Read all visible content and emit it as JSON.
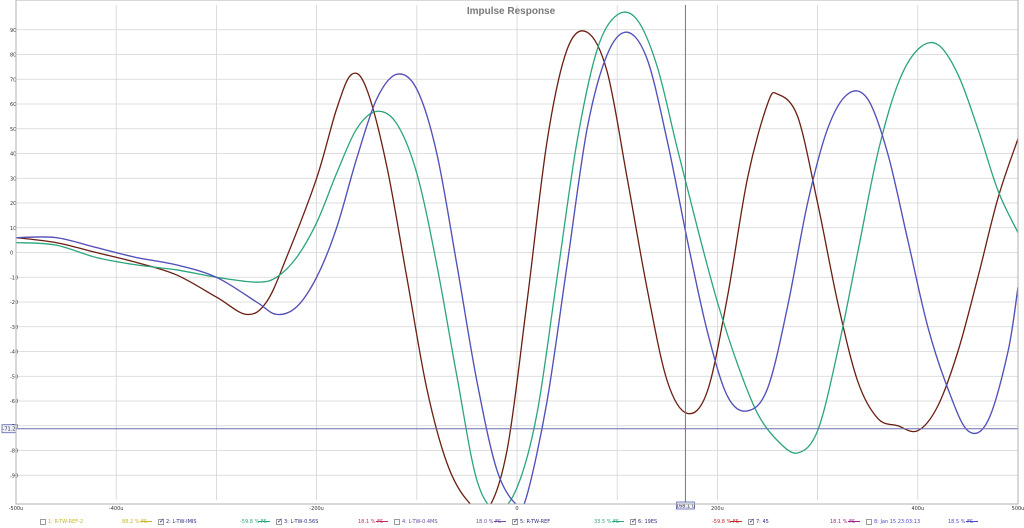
{
  "chart_data": {
    "type": "line",
    "title": "Impulse Response",
    "xlabel": "",
    "ylabel": "",
    "xlim": [
      -500,
      500
    ],
    "ylim": [
      -100,
      100
    ],
    "x_ticks": [
      {
        "value": -500,
        "label": "-500u"
      },
      {
        "value": -400,
        "label": "-400u"
      },
      {
        "value": -200,
        "label": "-200u"
      },
      {
        "value": 0,
        "label": "0"
      },
      {
        "value": 200,
        "label": "200u"
      },
      {
        "value": 400,
        "label": "400u"
      },
      {
        "value": 500,
        "label": "500u"
      }
    ],
    "y_ticks": [
      {
        "value": 90,
        "label": "90"
      },
      {
        "value": 80,
        "label": "80"
      },
      {
        "value": 70,
        "label": "70"
      },
      {
        "value": 60,
        "label": "60"
      },
      {
        "value": 50,
        "label": "50"
      },
      {
        "value": 40,
        "label": "40"
      },
      {
        "value": 30,
        "label": "30"
      },
      {
        "value": 20,
        "label": "20"
      },
      {
        "value": 10,
        "label": "10"
      },
      {
        "value": 0,
        "label": "0"
      },
      {
        "value": -10,
        "label": "-10"
      },
      {
        "value": -20,
        "label": "-20"
      },
      {
        "value": -30,
        "label": "-30"
      },
      {
        "value": -40,
        "label": "-40"
      },
      {
        "value": -50,
        "label": "-50"
      },
      {
        "value": -60,
        "label": "-60"
      },
      {
        "value": -70,
        "label": "-70"
      },
      {
        "value": -80,
        "label": "-80"
      },
      {
        "value": -90,
        "label": "-90"
      }
    ],
    "grid": true,
    "cursor": {
      "x": 168.1,
      "y": -71.2,
      "x_label": "168.1 u",
      "y_label": "-71.2"
    },
    "series": [
      {
        "name": "6: 19ES",
        "color": "#6b1e12",
        "points": [
          [
            -500,
            6
          ],
          [
            -460,
            4
          ],
          [
            -420,
            0
          ],
          [
            -380,
            -4
          ],
          [
            -340,
            -9
          ],
          [
            -300,
            -18
          ],
          [
            -270,
            -25
          ],
          [
            -250,
            -20
          ],
          [
            -230,
            -2
          ],
          [
            -200,
            30
          ],
          [
            -180,
            58
          ],
          [
            -165,
            72
          ],
          [
            -150,
            66
          ],
          [
            -130,
            35
          ],
          [
            -110,
            -10
          ],
          [
            -90,
            -55
          ],
          [
            -70,
            -85
          ],
          [
            -50,
            -100
          ],
          [
            -30,
            -104
          ],
          [
            -10,
            -80
          ],
          [
            10,
            -20
          ],
          [
            30,
            45
          ],
          [
            50,
            82
          ],
          [
            70,
            89
          ],
          [
            90,
            73
          ],
          [
            110,
            30
          ],
          [
            130,
            -15
          ],
          [
            150,
            -52
          ],
          [
            170,
            -65
          ],
          [
            190,
            -56
          ],
          [
            210,
            -18
          ],
          [
            230,
            30
          ],
          [
            250,
            60
          ],
          [
            260,
            64
          ],
          [
            280,
            55
          ],
          [
            300,
            20
          ],
          [
            320,
            -20
          ],
          [
            340,
            -52
          ],
          [
            360,
            -67
          ],
          [
            380,
            -70
          ],
          [
            400,
            -72
          ],
          [
            420,
            -62
          ],
          [
            440,
            -40
          ],
          [
            460,
            -10
          ],
          [
            480,
            22
          ],
          [
            500,
            46
          ]
        ]
      },
      {
        "name": "2: L-TW-IMIS",
        "color": "#2ba57c",
        "points": [
          [
            -500,
            4
          ],
          [
            -460,
            3
          ],
          [
            -420,
            -2
          ],
          [
            -380,
            -5
          ],
          [
            -340,
            -7
          ],
          [
            -300,
            -10
          ],
          [
            -260,
            -12
          ],
          [
            -240,
            -10
          ],
          [
            -220,
            -2
          ],
          [
            -200,
            12
          ],
          [
            -180,
            32
          ],
          [
            -160,
            50
          ],
          [
            -140,
            57
          ],
          [
            -120,
            52
          ],
          [
            -100,
            32
          ],
          [
            -80,
            -5
          ],
          [
            -60,
            -50
          ],
          [
            -40,
            -92
          ],
          [
            -20,
            -104
          ],
          [
            0,
            -95
          ],
          [
            20,
            -65
          ],
          [
            40,
            -10
          ],
          [
            60,
            45
          ],
          [
            80,
            82
          ],
          [
            100,
            96
          ],
          [
            120,
            94
          ],
          [
            140,
            75
          ],
          [
            160,
            42
          ],
          [
            180,
            10
          ],
          [
            200,
            -20
          ],
          [
            220,
            -45
          ],
          [
            240,
            -65
          ],
          [
            260,
            -76
          ],
          [
            280,
            -81
          ],
          [
            300,
            -72
          ],
          [
            320,
            -40
          ],
          [
            340,
            0
          ],
          [
            360,
            40
          ],
          [
            380,
            68
          ],
          [
            400,
            82
          ],
          [
            420,
            84
          ],
          [
            440,
            72
          ],
          [
            460,
            50
          ],
          [
            480,
            25
          ],
          [
            500,
            8
          ]
        ]
      },
      {
        "name": "3: L-TW-0.56S",
        "color": "#a0238c",
        "points": [
          [
            -500,
            6
          ],
          [
            -460,
            6
          ],
          [
            -420,
            2
          ],
          [
            -380,
            -2
          ],
          [
            -340,
            -5
          ],
          [
            -300,
            -10
          ],
          [
            -260,
            -20
          ],
          [
            -240,
            -25
          ],
          [
            -220,
            -22
          ],
          [
            -200,
            -10
          ],
          [
            -180,
            10
          ],
          [
            -160,
            38
          ],
          [
            -140,
            62
          ],
          [
            -120,
            72
          ],
          [
            -100,
            66
          ],
          [
            -80,
            40
          ],
          [
            -60,
            -5
          ],
          [
            -40,
            -52
          ],
          [
            -20,
            -88
          ],
          [
            0,
            -102
          ],
          [
            10,
            -98
          ],
          [
            30,
            -60
          ],
          [
            50,
            -5
          ],
          [
            70,
            50
          ],
          [
            90,
            80
          ],
          [
            110,
            89
          ],
          [
            130,
            78
          ],
          [
            150,
            45
          ],
          [
            170,
            5
          ],
          [
            190,
            -32
          ],
          [
            210,
            -58
          ],
          [
            230,
            -64
          ],
          [
            250,
            -55
          ],
          [
            270,
            -22
          ],
          [
            290,
            20
          ],
          [
            310,
            50
          ],
          [
            330,
            64
          ],
          [
            350,
            62
          ],
          [
            370,
            40
          ],
          [
            390,
            5
          ],
          [
            410,
            -30
          ],
          [
            430,
            -55
          ],
          [
            450,
            -72
          ],
          [
            470,
            -68
          ],
          [
            490,
            -40
          ],
          [
            500,
            -14
          ]
        ]
      },
      {
        "name": "5: R-TW-REF",
        "color": "#3a5fc6",
        "points": [
          [
            -500,
            6
          ],
          [
            -460,
            6
          ],
          [
            -420,
            2
          ],
          [
            -380,
            -2
          ],
          [
            -340,
            -5
          ],
          [
            -300,
            -10
          ],
          [
            -260,
            -20
          ],
          [
            -240,
            -25
          ],
          [
            -220,
            -22
          ],
          [
            -200,
            -10
          ],
          [
            -180,
            10
          ],
          [
            -160,
            38
          ],
          [
            -140,
            62
          ],
          [
            -120,
            72
          ],
          [
            -100,
            66
          ],
          [
            -80,
            40
          ],
          [
            -60,
            -5
          ],
          [
            -40,
            -52
          ],
          [
            -20,
            -88
          ],
          [
            0,
            -102
          ],
          [
            10,
            -98
          ],
          [
            30,
            -60
          ],
          [
            50,
            -5
          ],
          [
            70,
            50
          ],
          [
            90,
            80
          ],
          [
            110,
            89
          ],
          [
            130,
            78
          ],
          [
            150,
            45
          ],
          [
            170,
            5
          ],
          [
            190,
            -32
          ],
          [
            210,
            -58
          ],
          [
            230,
            -64
          ],
          [
            250,
            -55
          ],
          [
            270,
            -22
          ],
          [
            290,
            20
          ],
          [
            310,
            50
          ],
          [
            330,
            64
          ],
          [
            350,
            62
          ],
          [
            370,
            40
          ],
          [
            390,
            5
          ],
          [
            410,
            -30
          ],
          [
            430,
            -55
          ],
          [
            450,
            -72
          ],
          [
            470,
            -68
          ],
          [
            490,
            -40
          ],
          [
            500,
            -14
          ]
        ]
      }
    ]
  },
  "legend": [
    {
      "name": "1: R-TW-REF-2",
      "level": "88.2 % FS",
      "checked": false,
      "color": "#c8b428"
    },
    {
      "name": "2: L-TW-IMIS",
      "level": "-59.8 % FS",
      "checked": true,
      "color": "#2ba57c"
    },
    {
      "name": "3: L-TW-0.56S",
      "level": "18.1 % FS",
      "checked": true,
      "color": "#c42b5a"
    },
    {
      "name": "4: L-TW-0.4MS",
      "level": "18.0 % FS",
      "checked": false,
      "color": "#6a4ea0"
    },
    {
      "name": "5: R-TW-REF",
      "level": "33.5 % FS",
      "checked": true,
      "color": "#2ba57c"
    },
    {
      "name": "6: 19ES",
      "level": "-59.8 % FS",
      "checked": true,
      "color": "#c42b2b"
    },
    {
      "name": "7: 45",
      "level": "18.1 % FS",
      "checked": true,
      "color": "#a0238c"
    },
    {
      "name": "8: Jan 15 23:03:13",
      "level": "18.5 % FS",
      "checked": false,
      "color": "#4a4ad0"
    }
  ]
}
